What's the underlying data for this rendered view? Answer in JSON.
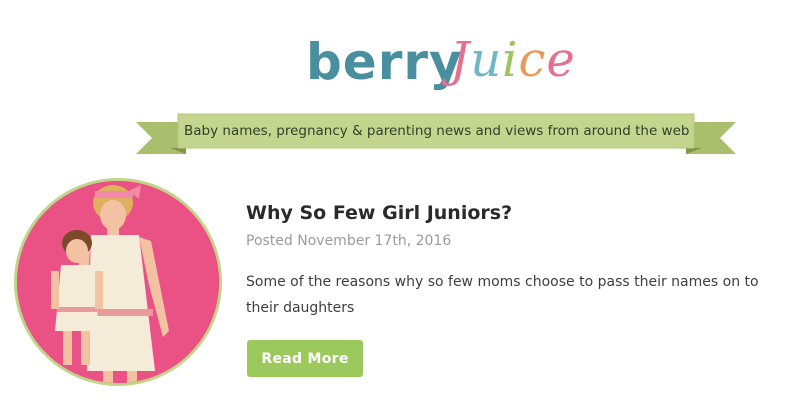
{
  "logo": {
    "word1": "berry",
    "word2_letters": [
      "J",
      "u",
      "i",
      "c",
      "e"
    ]
  },
  "banner": {
    "tagline": "Baby names, pregnancy & parenting news and views from around the web"
  },
  "post": {
    "title": "Why So Few Girl Juniors?",
    "date": "Posted November 17th, 2016",
    "excerpt": "Some of the reasons why so few moms choose to pass their names on to their daughters",
    "read_more_label": "Read More",
    "image_icon": "photo-mother-daughter"
  },
  "colors": {
    "logo_blue": "#4a8fa0",
    "ribbon_green": "#c4d58e",
    "ribbon_dark": "#9db464",
    "button_green": "#9cc95b",
    "photo_pink": "#e7447c"
  }
}
